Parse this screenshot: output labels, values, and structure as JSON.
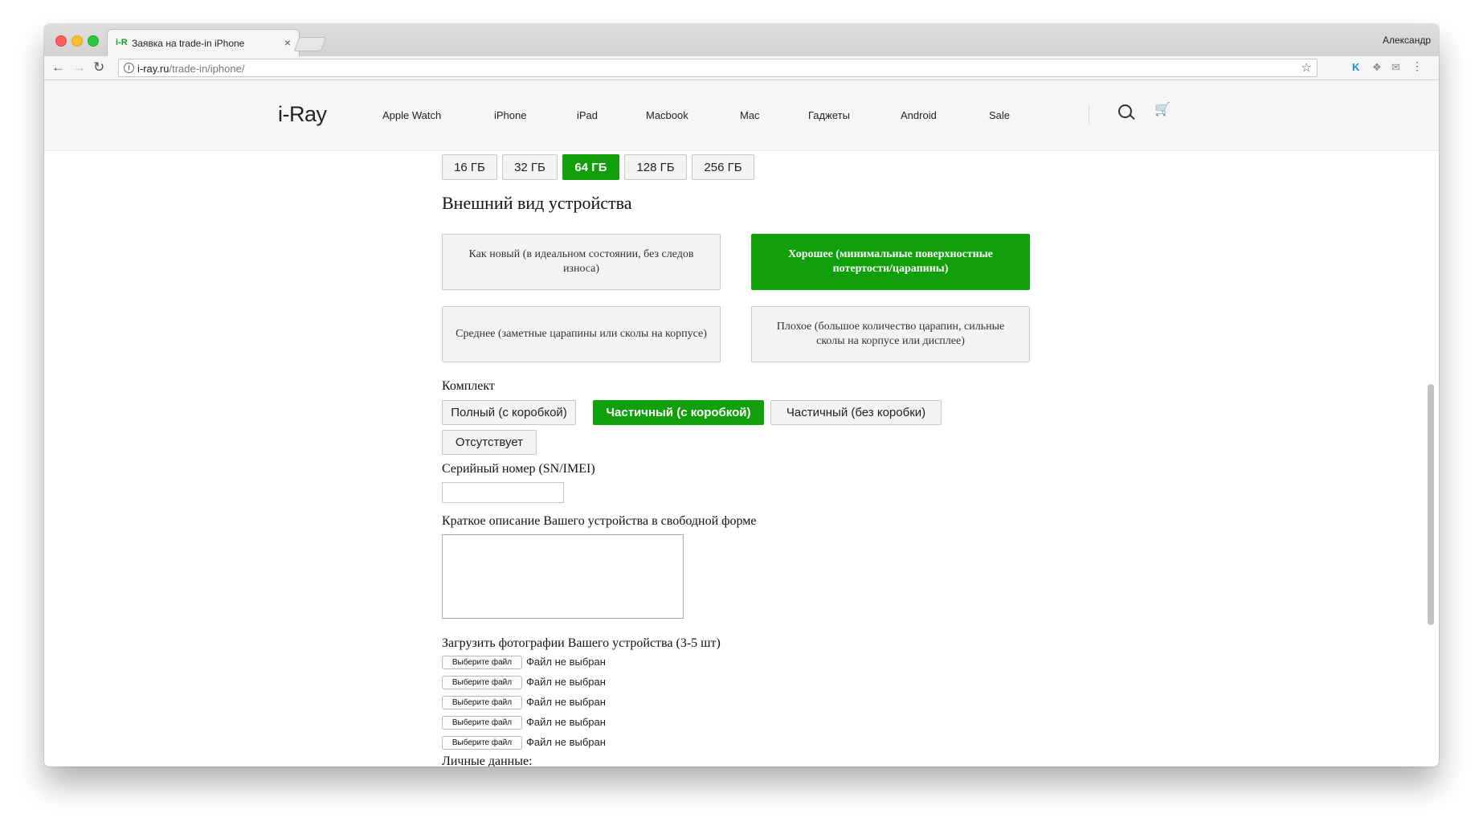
{
  "browser": {
    "tab_favicon": "i-R",
    "tab_title": "Заявка на trade-in iPhone",
    "tab_close": "×",
    "profile_name": "Александр",
    "url_host": "i-ray.ru",
    "url_path": "/trade-in/iphone/"
  },
  "site": {
    "logo": "i-Ray",
    "nav": [
      "Apple Watch",
      "iPhone",
      "iPad",
      "Macbook",
      "Mac",
      "Гаджеты",
      "Android",
      "Sale"
    ]
  },
  "memory": {
    "options": [
      "16 ГБ",
      "32 ГБ",
      "64 ГБ",
      "128 ГБ",
      "256 ГБ"
    ],
    "selected": "64 ГБ"
  },
  "appearance": {
    "title": "Внешний вид устройства",
    "options": [
      "Как новый (в идеальном состоянии, без следов износа)",
      "Хорошее (минимальные поверхностные потертости/царапины)",
      "Среднее (заметные царапины или сколы на корпусе)",
      "Плохое (большое количество царапин, сильные сколы на корпусе или дисплее)"
    ],
    "selected": "Хорошее (минимальные поверхностные потертости/царапины)"
  },
  "kit": {
    "title": "Комплект",
    "options": [
      "Полный (с коробкой)",
      "Частичный (с коробкой)",
      "Частичный (без коробки)",
      "Отсутствует"
    ],
    "selected": "Частичный (с коробкой)"
  },
  "serial": {
    "label": "Серийный номер (SN/IMEI)",
    "value": ""
  },
  "description": {
    "label": "Краткое описание Вашего устройства в свободной форме",
    "value": ""
  },
  "photos": {
    "label": "Загрузить фотографии Вашего устройства (3-5 шт)",
    "button_label": "Выберите файл",
    "no_file": "Файл не выбран",
    "count": 5
  },
  "personal": {
    "label": "Личные данные:"
  },
  "colors": {
    "accent": "#119f0c",
    "button_bg": "#f3f3f3",
    "border": "#c8c8c8"
  },
  "icons": [
    "back-icon",
    "forward-icon",
    "reload-icon",
    "info-icon",
    "star-icon",
    "search-icon",
    "cart-icon",
    "menu-icon"
  ]
}
